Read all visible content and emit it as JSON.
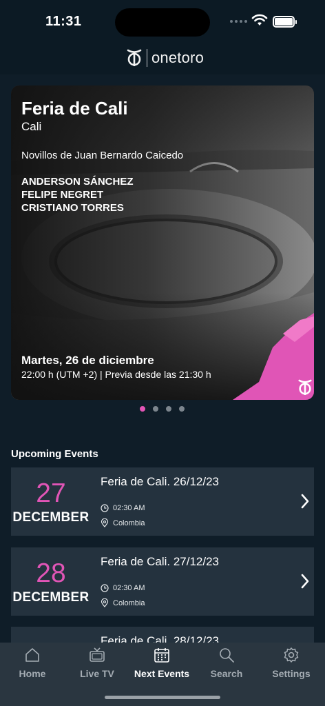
{
  "status_bar": {
    "time": "11:31"
  },
  "header": {
    "logo_text": "onetoro"
  },
  "hero": {
    "title": "Feria de Cali",
    "city": "Cali",
    "novillos": "Novillos de Juan Bernardo Caicedo",
    "toreros": [
      "ANDERSON SÁNCHEZ",
      "FELIPE NEGRET",
      "CRISTIANO TORRES"
    ],
    "date": "Martes, 26 de diciembre",
    "hour": "22:00 h (UTM +2) | Previa desde las 21:30 h"
  },
  "carousel": {
    "count": 4,
    "active_index": 0
  },
  "section_title": "Upcoming Events",
  "events": [
    {
      "day": "27",
      "month": "DECEMBER",
      "title": "Feria de Cali. 26/12/23",
      "time": "02:30 AM",
      "location": "Colombia"
    },
    {
      "day": "28",
      "month": "DECEMBER",
      "title": "Feria de Cali. 27/12/23",
      "time": "02:30 AM",
      "location": "Colombia"
    },
    {
      "day": "",
      "month": "",
      "title": "Feria de Cali. 28/12/23",
      "time": "",
      "location": ""
    }
  ],
  "tabs": [
    {
      "label": "Home",
      "icon": "home-icon"
    },
    {
      "label": "Live TV",
      "icon": "tv-icon"
    },
    {
      "label": "Next Events",
      "icon": "calendar-icon"
    },
    {
      "label": "Search",
      "icon": "search-icon"
    },
    {
      "label": "Settings",
      "icon": "gear-icon"
    }
  ],
  "active_tab": "Next Events",
  "colors": {
    "accent": "#e055b6",
    "background": "#0f1d28",
    "card": "#24323e",
    "tab_bar": "#2a3640"
  }
}
